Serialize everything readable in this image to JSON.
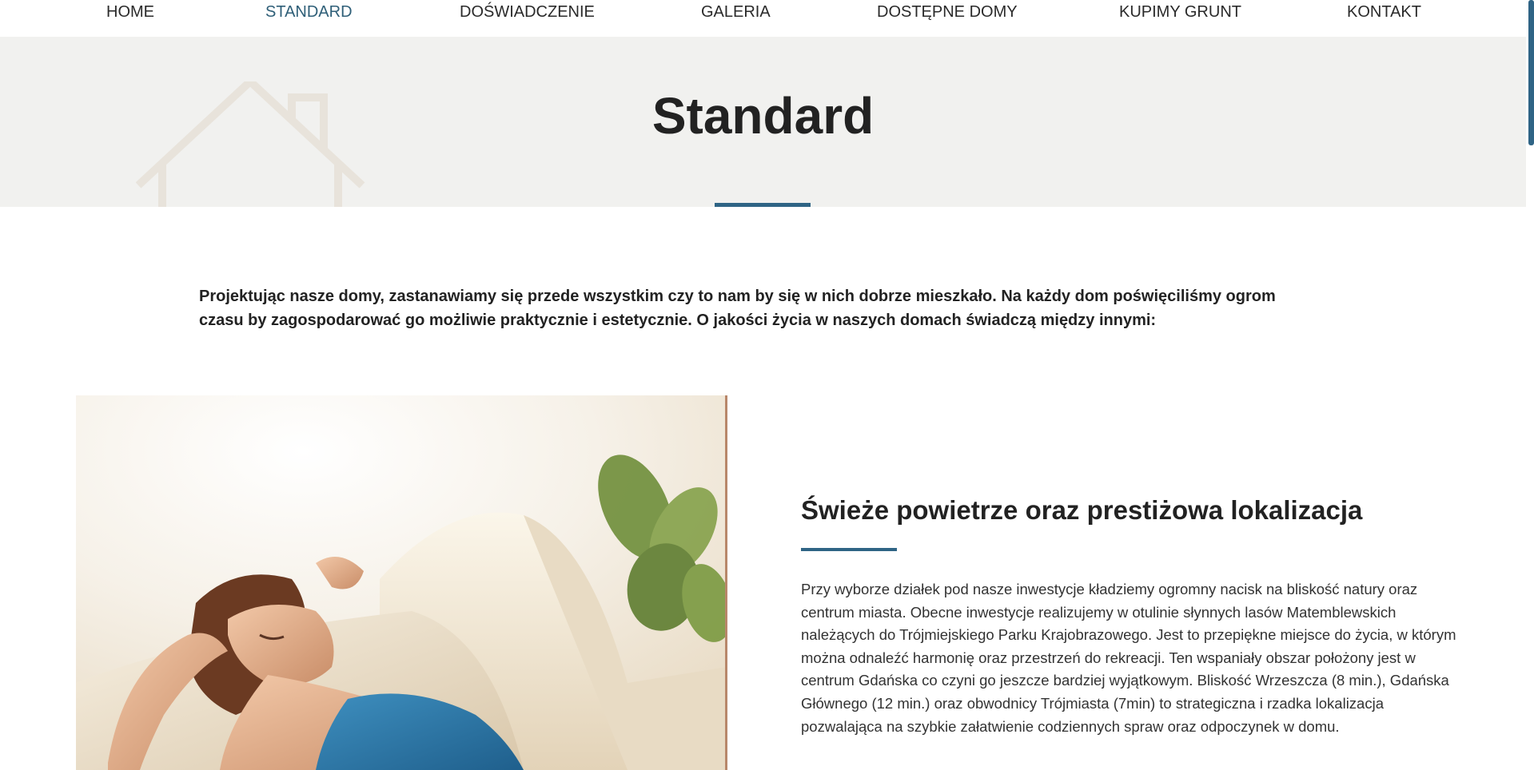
{
  "nav": {
    "items": [
      {
        "label": "HOME"
      },
      {
        "label": "STANDARD"
      },
      {
        "label": "DOŚWIADCZENIE"
      },
      {
        "label": "GALERIA"
      },
      {
        "label": "DOSTĘPNE DOMY"
      },
      {
        "label": "KUPIMY GRUNT"
      },
      {
        "label": "KONTAKT"
      }
    ],
    "active": "STANDARD"
  },
  "hero": {
    "title": "Standard"
  },
  "intro": {
    "text": "Projektując nasze domy, zastanawiamy się przede wszystkim czy to nam by się w nich dobrze mieszkało. Na każdy dom poświęciliśmy ogrom czasu by zagospodarować go możliwie praktycznie i estetycznie. O jakości życia w naszych domach świadczą między innymi:"
  },
  "feature": {
    "title": "Świeże powietrze oraz prestiżowa lokalizacja",
    "text": "Przy wyborze działek pod nasze inwestycje kładziemy ogromny nacisk na bliskość natury oraz centrum miasta. Obecne inwestycje realizujemy w otulinie słynnych lasów Matemblewskich należących do Trójmiejskiego Parku Krajobrazowego. Jest to przepiękne miejsce do życia, w którym można odnaleźć harmonię oraz przestrzeń do rekreacji. Ten wspaniały obszar położony jest w centrum Gdańska co czyni go jeszcze bardziej wyjątkowym. Bliskość Wrzeszcza (8 min.), Gdańska Głównego (12 min.) oraz obwodnicy Trójmiasta (7min) to strategiczna i rzadka lokalizacja pozwalająca na szybkie załatwienie codziennych spraw oraz odpoczynek w domu."
  },
  "colors": {
    "accent": "#2f6485",
    "active_nav": "#2f5f78",
    "hero_bg": "#f1f1ef"
  },
  "icons": {
    "house": "house-outline-icon"
  }
}
